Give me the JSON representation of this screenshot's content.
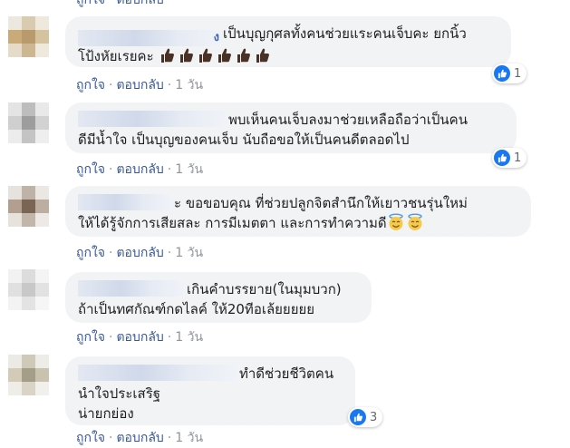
{
  "colors": {
    "link": "#385898",
    "meta": "#90949c",
    "bubble": "#f2f3f5",
    "like_blue": "#1877f2"
  },
  "top_actions": {
    "like": "ถูกใจ",
    "reply": "ตอบกลับ"
  },
  "comments": [
    {
      "line1": "เป็นบุญกุศลทั้งคนช่วยแระคนเจ็บคะ ยกนิ้ว",
      "line2": "โป้งหัยเรยคะ",
      "emoji_icons": [
        "thumbs-up-dark-skin-icon",
        "thumbs-up-dark-skin-icon",
        "thumbs-up-dark-skin-icon",
        "thumbs-up-dark-skin-icon",
        "thumbs-up-dark-skin-icon",
        "thumbs-up-dark-skin-icon"
      ],
      "like": "ถูกใจ",
      "reply": "ตอบกลับ",
      "time": "1 วัน",
      "reaction_count": "1"
    },
    {
      "line1": "พบเห็นคนเจ็บลงมาช่วยเหลือถือว่าเป็นคน",
      "line2": "ดีมีน้ำใจ เป็นบุญของคนเจ็บ นับถือขอให้เป็นคนดีตลอดไป",
      "like": "ถูกใจ",
      "reply": "ตอบกลับ",
      "time": "1 วัน",
      "reaction_count": "1"
    },
    {
      "line1": "ะ ขอขอบคุณ ที่ช่วยปลูกจิตสำนึกให้เยาวชนรุ่นใหม่",
      "line2": "ให้ได้รู้จักการเสียสละ การมีเมตตา และการทำความดี",
      "emoji_icons": [
        "smiling-face-with-halo-icon",
        "smiling-face-with-halo-icon"
      ],
      "like": "ถูกใจ",
      "reply": "ตอบกลับ",
      "time": "1 วัน"
    },
    {
      "line1": "เกินคำบรรยาย(ในมุมบวก)",
      "line2": "ถ้าเป็นทศกัณฑ์กดไลค์ ให้20ทีอเล้ยยยยย",
      "like": "ถูกใจ",
      "reply": "ตอบกลับ",
      "time": "1 วัน"
    },
    {
      "line1": "ทำดีช่วยชีวิตคน",
      "line2": "นำใจประเสริฐ",
      "line3": "น่ายกย่อง",
      "like": "ถูกใจ",
      "reply": "ตอบกลับ",
      "time": "1 วัน",
      "reaction_count": "3"
    }
  ]
}
